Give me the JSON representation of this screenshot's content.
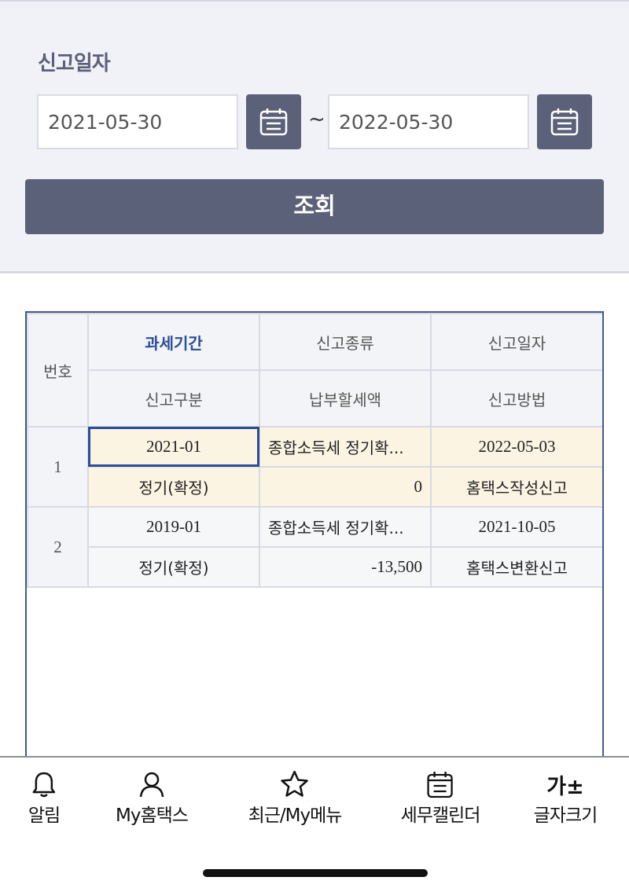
{
  "search": {
    "title": "신고일자",
    "start_date": "2021-05-30",
    "end_date": "2022-05-30",
    "separator": "~",
    "query_label": "조회"
  },
  "table": {
    "headers": {
      "no": "번호",
      "row1": [
        "과세기간",
        "신고종류",
        "신고일자"
      ],
      "row2": [
        "신고구분",
        "납부할세액",
        "신고방법"
      ]
    },
    "rows": [
      {
        "no": "1",
        "period": "2021-01",
        "type": "종합소득세 정기확...",
        "date": "2022-05-03",
        "category": "정기(확정)",
        "tax": "0",
        "method": "홈택스작성신고"
      },
      {
        "no": "2",
        "period": "2019-01",
        "type": "종합소득세 정기확...",
        "date": "2021-10-05",
        "category": "정기(확정)",
        "tax": "-13,500",
        "method": "홈택스변환신고"
      }
    ]
  },
  "nav": [
    {
      "label": "알림",
      "icon": "bell-icon"
    },
    {
      "label": "My홈택스",
      "icon": "person-icon"
    },
    {
      "label": "최근/My메뉴",
      "icon": "star-icon"
    },
    {
      "label": "세무캘린더",
      "icon": "calendar-icon"
    },
    {
      "label": "글자크기",
      "icon": "font-size-icon",
      "icon_text": "가±"
    }
  ],
  "colors": {
    "accent": "#5a6178",
    "header_active": "#2a4d96",
    "selected_row": "#fcf4e3"
  }
}
